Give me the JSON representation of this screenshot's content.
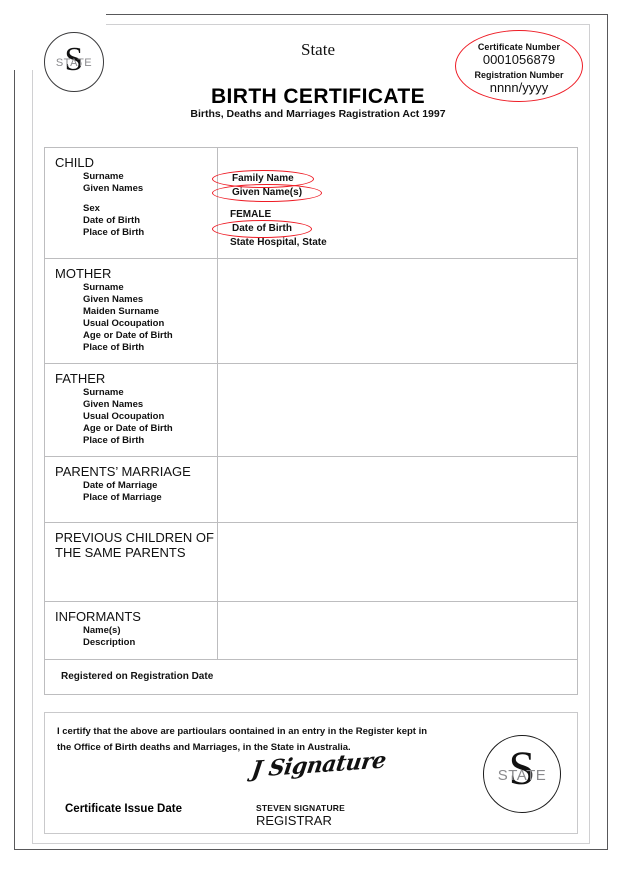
{
  "header": {
    "state": "State",
    "title": "BIRTH CERTIFICATE",
    "act": "Births, Deaths and Marriages Ragistration Act 1997"
  },
  "seal": {
    "letter": "S",
    "word": "STATE"
  },
  "certificate_oval": {
    "certificate_number_label": "Certificate Number",
    "certificate_number_value": "0001056879",
    "registration_number_label": "Registration Number",
    "registration_number_value": "nnnn/yyyy",
    "outline_color": "#ee1c25"
  },
  "sections": {
    "child": {
      "heading": "CHILD",
      "labels": {
        "surname": "Surname",
        "given_names": "Given Names",
        "sex": "Sex",
        "date_of_birth": "Date of Birth",
        "place_of_birth": "Place of Birth"
      },
      "values": {
        "surname": "Family Name",
        "given_names": "Given Name(s)",
        "sex": "FEMALE",
        "date_of_birth": "Date of Birth",
        "place_of_birth": "State Hospital, State"
      }
    },
    "mother": {
      "heading": "MOTHER",
      "labels": {
        "surname": "Surname",
        "given_names": "Given Names",
        "maiden_surname": "Maiden Surname",
        "usual_occupation": "Usual Ocoupation",
        "age_or_dob": "Age or Date of Birth",
        "place_of_birth": "Place of Birth"
      }
    },
    "father": {
      "heading": "FATHER",
      "labels": {
        "surname": "Surname",
        "given_names": "Given Names",
        "usual_occupation": "Usual Ocoupation",
        "age_or_dob": "Age or Date of Birth",
        "place_of_birth": "Place of Birth"
      }
    },
    "parents_marriage": {
      "heading": "PARENTS’ MARRIAGE",
      "labels": {
        "date_of_marriage": "Date of Marriage",
        "place_of_marriage": "Place of Marriage"
      }
    },
    "previous_children": {
      "heading": "PREVIOUS CHILDREN OF\nTHE SAME PARENTS"
    },
    "informants": {
      "heading": "INFORMANTS",
      "labels": {
        "names": "Name(s)",
        "description": "Description"
      }
    },
    "registered": {
      "text": "Registered on Registration Date"
    }
  },
  "certification": {
    "statement_line1": "I certify that the above are partioulars oontained in an entry in the Register kept in",
    "statement_line2": "the Office of Birth deaths and Marriages, in the State in Australia.",
    "issue_date_label": "Certificate Issue Date",
    "signature_script": "J Signature",
    "signature_name": "STEVEN SIGNATURE",
    "signature_role": "REGISTRAR"
  }
}
